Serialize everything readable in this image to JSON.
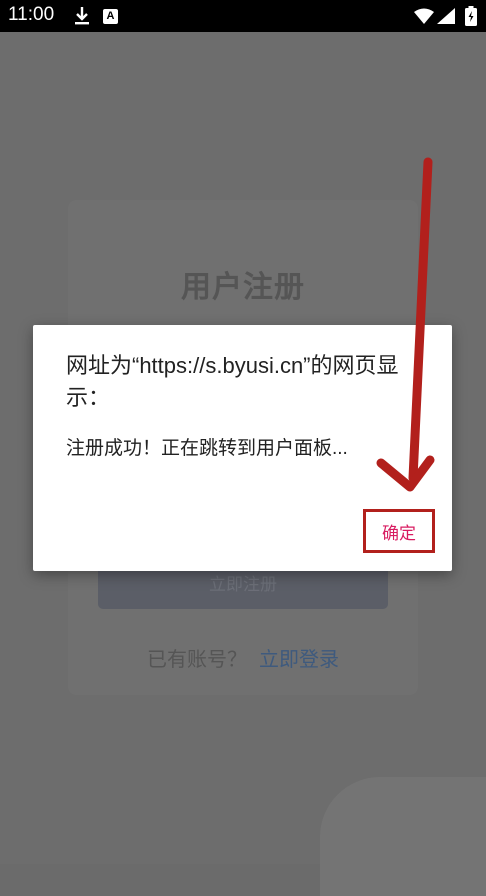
{
  "status_bar": {
    "time": "11:00",
    "icons": [
      "download-icon",
      "a-icon",
      "wifi-icon",
      "signal-icon",
      "battery-icon"
    ],
    "a_label": "A"
  },
  "background_page": {
    "title": "用户注册",
    "register_button_label": "立即注册",
    "login_prompt": "已有账号？",
    "login_link": "立即登录"
  },
  "dialog": {
    "title": "网址为“https://s.byusi.cn”的网页显示：",
    "message": "注册成功！正在跳转到用户面板...",
    "ok_label": "确定"
  },
  "annotation": {
    "arrow_color": "#b2201c",
    "highlight_color": "#b2201c"
  }
}
